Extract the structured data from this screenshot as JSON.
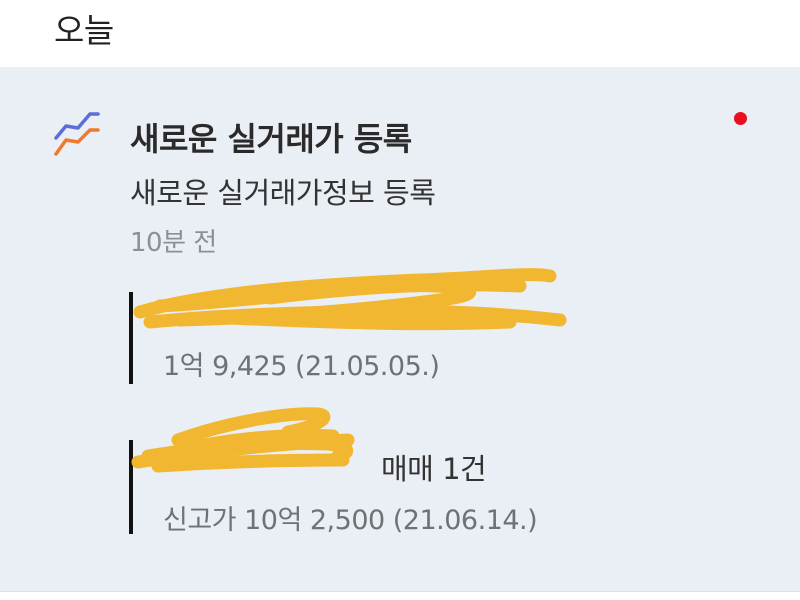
{
  "section": {
    "title": "오늘"
  },
  "notification": {
    "icon": "trend-chart-icon",
    "title": "새로운 실거래가 등록",
    "body": "새로운 실거래가정보 등록",
    "time": "10분 전",
    "unread_color": "#e8101c",
    "entries": [
      {
        "name": "",
        "detail": "1억 9,425 (21.05.05.)"
      },
      {
        "name": "매매 1건",
        "detail": "신고가 10억 2,500 (21.06.14.)"
      }
    ]
  },
  "colors": {
    "card_background": "#eaeef5",
    "icon_blue": "#5b6fd6",
    "icon_orange": "#f07a2b",
    "redaction": "#f2b731"
  }
}
